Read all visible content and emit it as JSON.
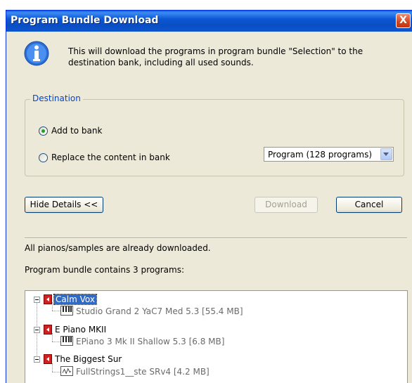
{
  "window": {
    "title": "Program Bundle Download",
    "close_label": "X"
  },
  "info": {
    "message": "This will download the programs in program bundle \"Selection\" to the destination bank, including all used sounds."
  },
  "destination": {
    "legend": "Destination",
    "option_add": "Add to bank",
    "option_replace": "Replace the content in bank",
    "selected": "add",
    "bank_select_value": "Program (128 programs)"
  },
  "buttons": {
    "hide_details": "Hide Details <<",
    "download": "Download",
    "cancel": "Cancel"
  },
  "details": {
    "status": "All pianos/samples are already downloaded.",
    "contains": "Program bundle contains 3 programs:"
  },
  "tree": {
    "programs": [
      {
        "name": "Calm Vox",
        "sound": "Studio Grand 2 YaC7  Med 5.3 [55.4 MB]",
        "sound_icon": "piano-icon"
      },
      {
        "name": "E Piano MKII",
        "sound": "EPiano 3  Mk II Shallow 5.3 [6.8 MB]",
        "sound_icon": "piano-icon"
      },
      {
        "name": "The Biggest Sur",
        "sound": "FullStrings1__ste SRv4 [4.2 MB]",
        "sound_icon": "wave-icon"
      }
    ]
  }
}
